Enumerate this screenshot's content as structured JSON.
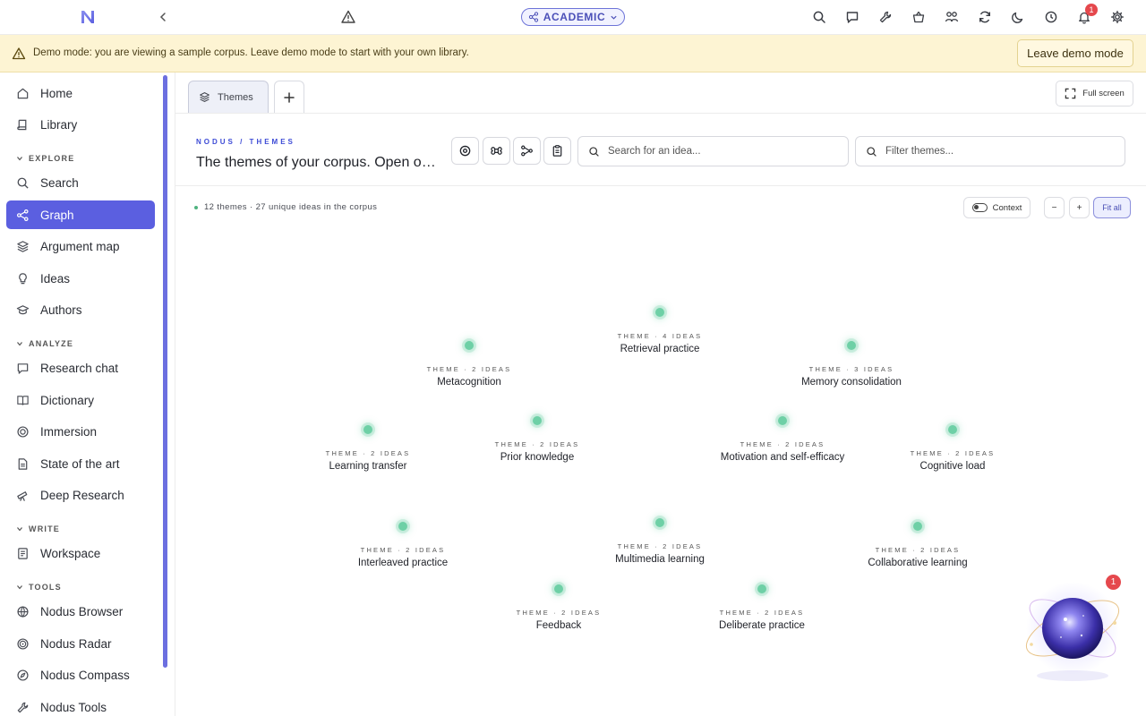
{
  "topbar": {
    "mode_label": "ACADEMIC",
    "notification_count": "1",
    "icons": [
      "search-icon",
      "chat-icon",
      "wrench-icon",
      "basket-icon",
      "people-icon",
      "refresh-icon",
      "moon-icon",
      "history-icon",
      "bell-icon",
      "gear-icon"
    ]
  },
  "banner": {
    "text": "Demo mode: you are viewing a sample corpus. Leave demo mode to start with your own library.",
    "button_label": "Leave demo mode"
  },
  "sidebar": {
    "home": "Home",
    "library": "Library",
    "explore_title": "EXPLORE",
    "explore": [
      "Search",
      "Graph",
      "Argument map",
      "Ideas",
      "Authors"
    ],
    "analyze_title": "ANALYZE",
    "analyze": [
      "Research chat",
      "Dictionary",
      "Immersion",
      "State of the art",
      "Deep Research"
    ],
    "write_title": "WRITE",
    "write": [
      "Workspace"
    ],
    "tools_title": "TOOLS",
    "tools": [
      "Nodus Browser",
      "Nodus Radar",
      "Nodus Compass",
      "Nodus Tools"
    ],
    "active": "Graph"
  },
  "tabs": {
    "themes_label": "Themes",
    "fullscreen_label": "Full screen"
  },
  "header": {
    "breadcrumb": "NODUS / THEMES",
    "title": "The themes of your corpus. Open one to see its ideas",
    "search_placeholder": "Search for an idea...",
    "filter_placeholder": "Filter themes..."
  },
  "graph": {
    "stats": "12 themes · 27 unique ideas in the corpus",
    "context_label": "Context",
    "zoom_out": "−",
    "zoom_in": "+",
    "fit_label": "Fit all",
    "accent_color": "#6ed0a6",
    "nodes": [
      {
        "meta": "THEME · 4 IDEAS",
        "label": "Retrieval practice"
      },
      {
        "meta": "THEME · 2 IDEAS",
        "label": "Metacognition"
      },
      {
        "meta": "THEME · 3 IDEAS",
        "label": "Memory consolidation"
      },
      {
        "meta": "THEME · 2 IDEAS",
        "label": "Learning transfer"
      },
      {
        "meta": "THEME · 2 IDEAS",
        "label": "Prior knowledge"
      },
      {
        "meta": "THEME · 2 IDEAS",
        "label": "Motivation and self-efficacy"
      },
      {
        "meta": "THEME · 2 IDEAS",
        "label": "Cognitive load"
      },
      {
        "meta": "THEME · 2 IDEAS",
        "label": "Interleaved practice"
      },
      {
        "meta": "THEME · 2 IDEAS",
        "label": "Multimedia learning"
      },
      {
        "meta": "THEME · 2 IDEAS",
        "label": "Collaborative learning"
      },
      {
        "meta": "THEME · 2 IDEAS",
        "label": "Feedback"
      },
      {
        "meta": "THEME · 2 IDEAS",
        "label": "Deliberate practice"
      }
    ]
  },
  "assistant": {
    "badge_count": "1"
  }
}
